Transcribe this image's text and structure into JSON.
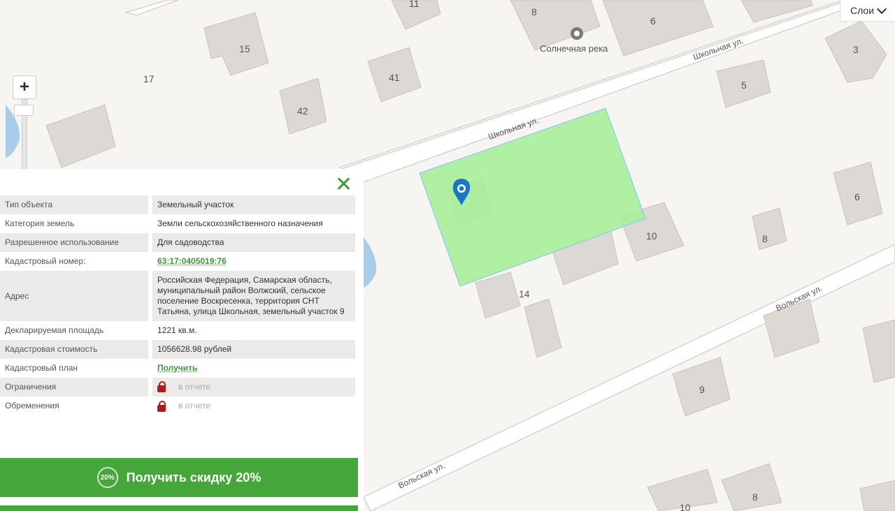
{
  "map": {
    "layers_label": "Слои",
    "poi_label": "Солнечная река",
    "streets": [
      "Школьная ул.",
      "Школьная ул.",
      "Вольская ул.",
      "Вольская ул."
    ],
    "house_numbers": [
      "11",
      "8",
      "6",
      "15",
      "17",
      "41",
      "42",
      "5",
      "3",
      "10",
      "6",
      "8",
      "14",
      "9",
      "8",
      "10"
    ],
    "parcel_color": "#a8ef9a"
  },
  "panel": {
    "rows": [
      {
        "label": "Тип объекта",
        "value": "Земельный участок"
      },
      {
        "label": "Категория земель",
        "value": "Земли сельскохозяйственного назначения"
      },
      {
        "label": "Разрешенное использование",
        "value": "Для садоводства"
      },
      {
        "label": "Кадастровый номер:",
        "value": "63:17:0405019:76"
      },
      {
        "label": "Адрес",
        "value": "Российская Федерация, Самарская область, муниципальный район Волжский, сельское поселение Воскресенка, территория СНТ Татьяна, улица Школьная, земельный участок 9"
      },
      {
        "label": "Декларируемая площадь",
        "value": "1221 кв.м."
      },
      {
        "label": "Кадастровая стоимость",
        "value": "1056628.98 рублей"
      },
      {
        "label": "Кадастровый план",
        "value": "Получить"
      },
      {
        "label": "Ограничения",
        "value": "в отчете"
      },
      {
        "label": "Обременения",
        "value": "в отчете"
      }
    ],
    "cta_badge": "20%",
    "cta_label": "Получить скидку 20%"
  },
  "icons": {
    "close": "close-icon",
    "lock": "lock-icon",
    "marker": "map-marker-icon",
    "zoom": "plus-icon",
    "chevron": "chevron-down-icon"
  }
}
